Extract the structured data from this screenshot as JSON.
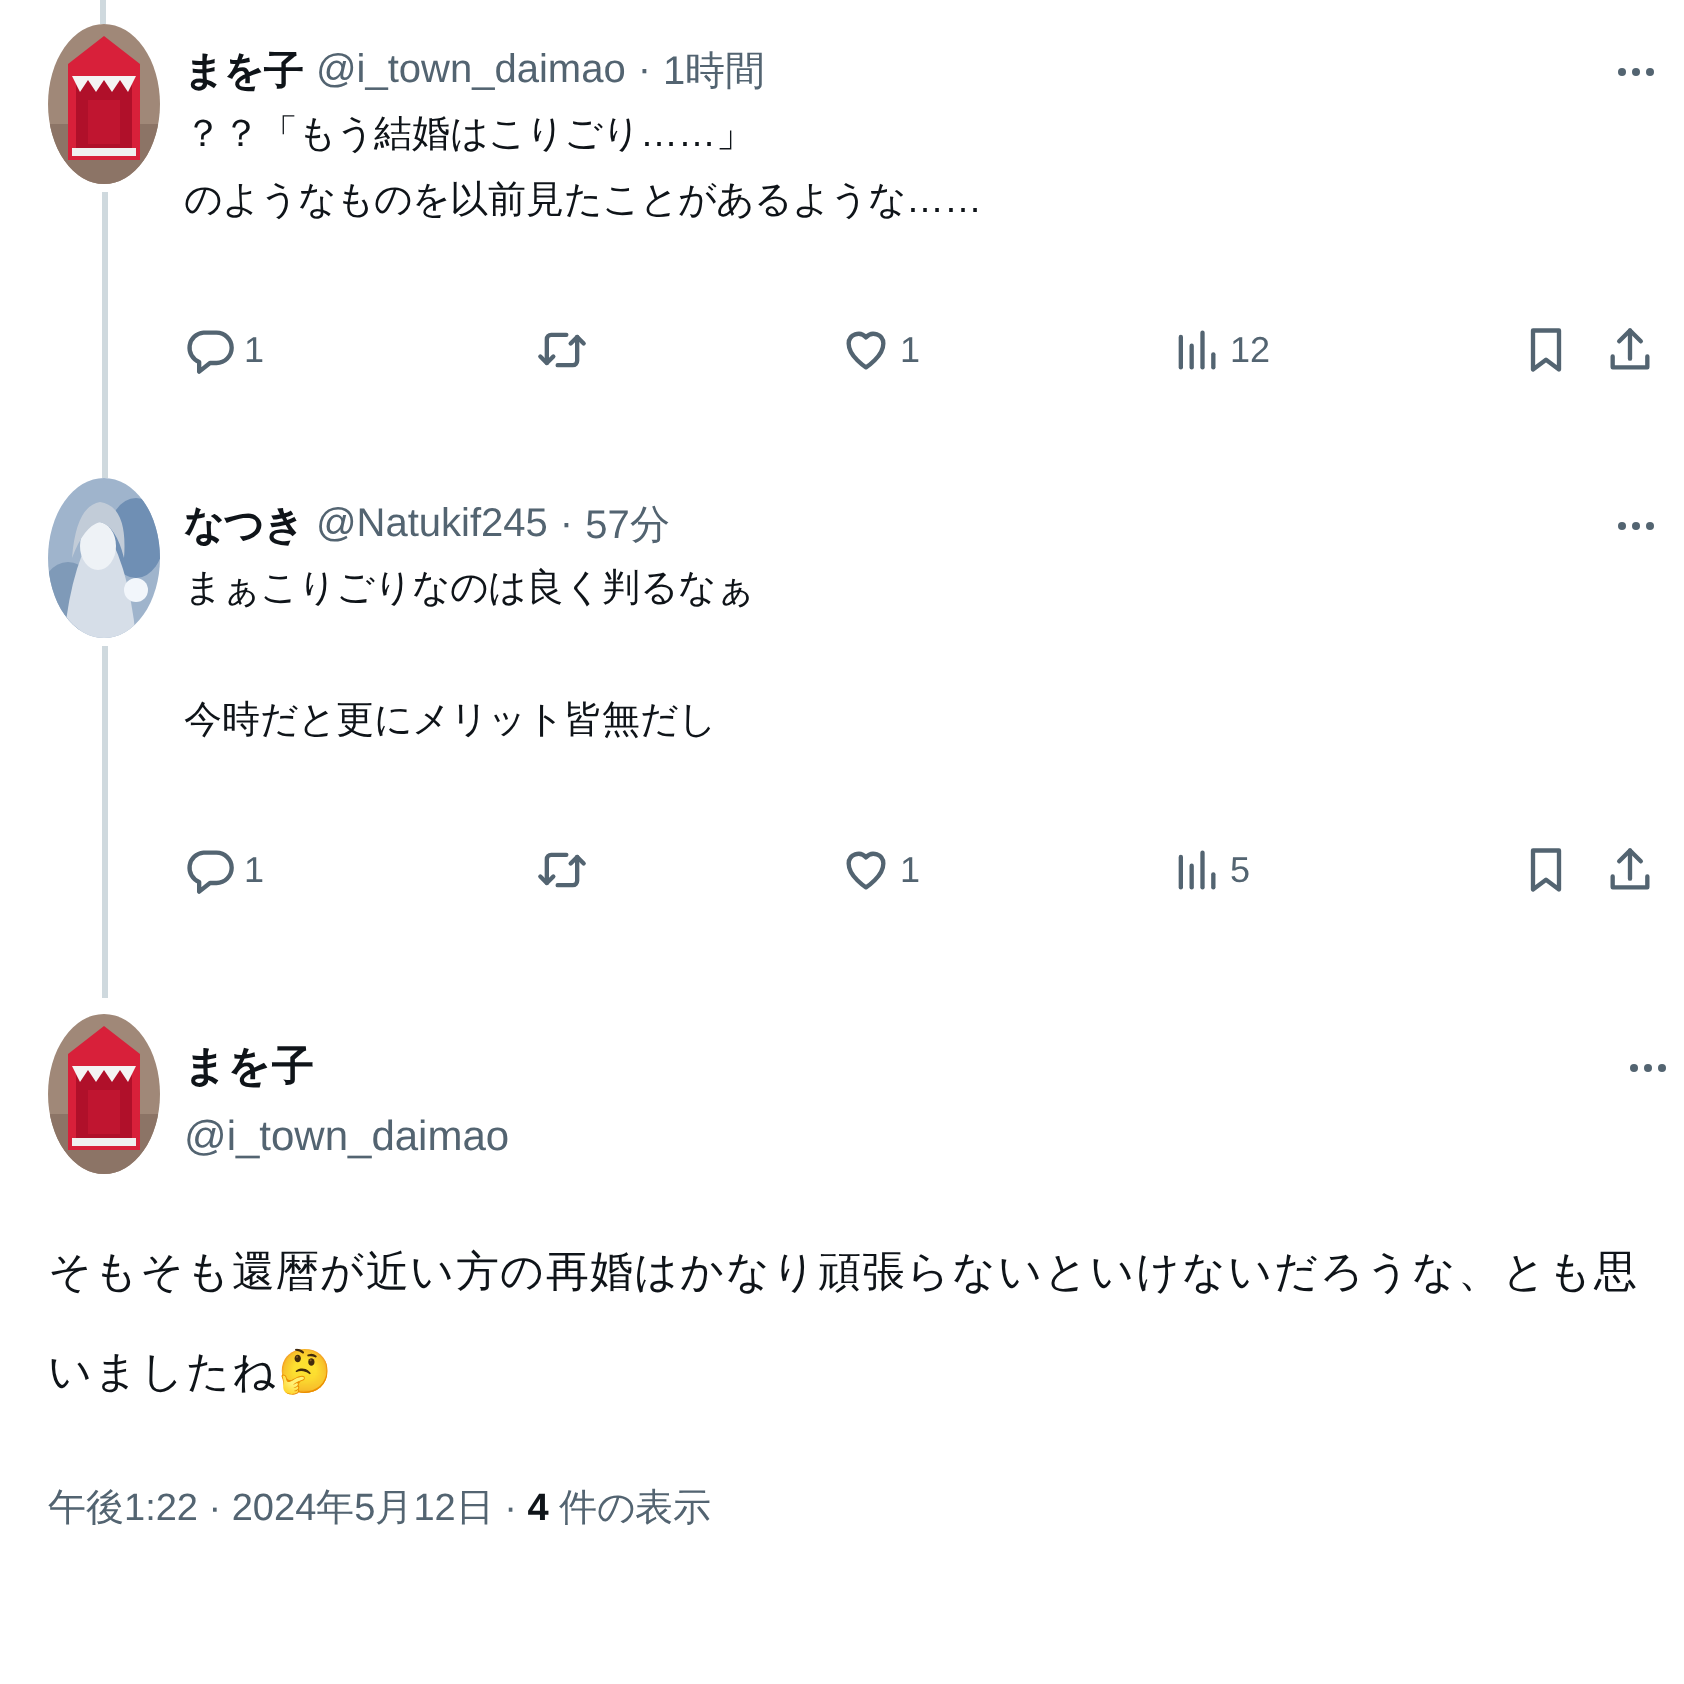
{
  "replies": [
    {
      "name": "まを子",
      "handle": "@i_town_daimao",
      "separator": "·",
      "time": "1時間",
      "paragraphs": [
        [
          "？？「もう結婚はこりごり……」",
          "のようなものを以前見たことがあるような……"
        ]
      ],
      "stats": {
        "replies": "1",
        "likes": "1",
        "views": "12"
      }
    },
    {
      "name": "なつき",
      "handle": "@Natukif245",
      "separator": "·",
      "time": "57分",
      "paragraphs": [
        [
          "まぁこりごりなのは良く判るなぁ"
        ],
        [
          "今時だと更にメリット皆無だし"
        ]
      ],
      "stats": {
        "replies": "1",
        "likes": "1",
        "views": "5"
      }
    }
  ],
  "main": {
    "name": "まを子",
    "handle": "@i_town_daimao",
    "body": "そもそも還暦が近い方の再婚はかなり頑張らないといけないだろうな、とも思いましたね🤔",
    "meta": "午後1:22 · 2024年5月12日 · **4** 件の表示"
  }
}
